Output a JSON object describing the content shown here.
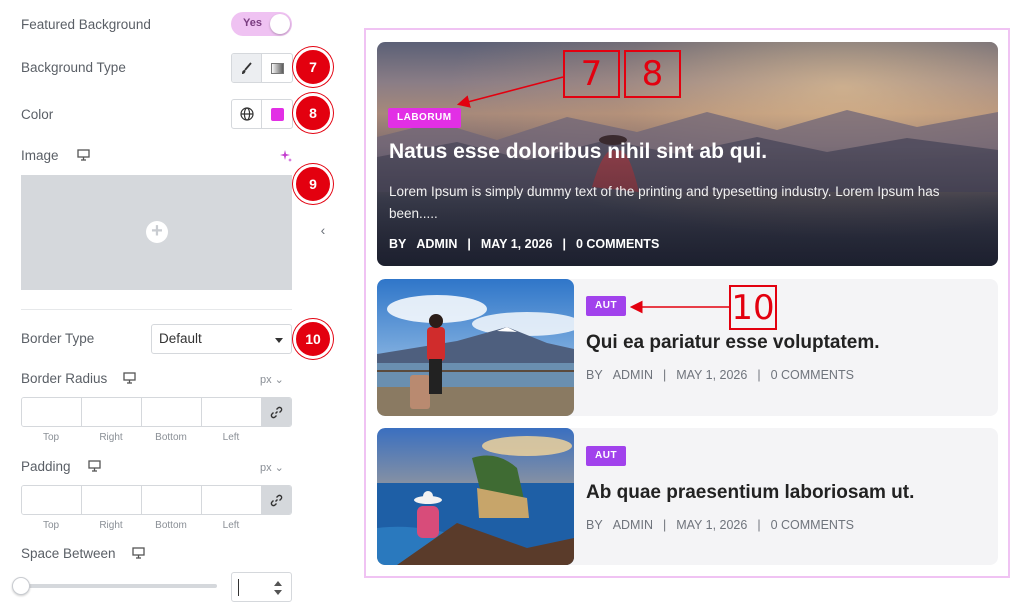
{
  "panel": {
    "featured_background_label": "Featured Background",
    "featured_background_toggle": "Yes",
    "background_type_label": "Background Type",
    "color_label": "Color",
    "image_label": "Image",
    "border_type_label": "Border Type",
    "border_type_value": "Default",
    "border_radius_label": "Border Radius",
    "border_radius_unit": "px",
    "padding_label": "Padding",
    "padding_unit": "px",
    "dim_labels": [
      "Top",
      "Right",
      "Bottom",
      "Left"
    ],
    "space_between_label": "Space Between",
    "color_swatch": "#e22fe5",
    "toggle_color": "#efc2f2"
  },
  "markers": [
    "7",
    "8",
    "9",
    "10"
  ],
  "callouts": {
    "seven": "7",
    "eight": "8",
    "ten": "10"
  },
  "preview": {
    "featured": {
      "badge": "LABORUM",
      "title": "Natus esse doloribus nihil sint ab qui.",
      "desc": "Lorem Ipsum is simply dummy text of the printing and typesetting industry. Lorem Ipsum has been.....",
      "by": "BY",
      "author": "ADMIN",
      "sep": "|",
      "date": "MAY 1, 2026",
      "comments": "0 COMMENTS"
    },
    "posts": [
      {
        "badge": "AUT",
        "title": "Qui ea pariatur esse voluptatem.",
        "by": "BY",
        "author": "ADMIN",
        "sep": "|",
        "date": "MAY 1, 2026",
        "comments": "0 COMMENTS"
      },
      {
        "badge": "AUT",
        "title": "Ab quae praesentium laboriosam ut.",
        "by": "BY",
        "author": "ADMIN",
        "sep": "|",
        "date": "MAY 1, 2026",
        "comments": "0 COMMENTS"
      }
    ],
    "badge_colors": {
      "featured": "#e22fe5",
      "post": "#a142ec"
    },
    "frame_color": "#f0c3f3",
    "annotation_color": "#e3000f"
  }
}
